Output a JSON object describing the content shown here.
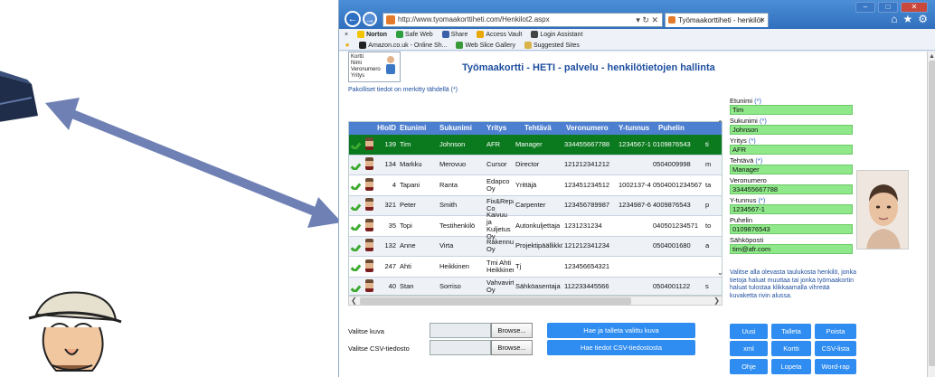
{
  "browser": {
    "url": "http://www.tyomaakorttiheti.com/Henkilot2.aspx",
    "tab_title": "Työmaakorttiheti - henkilöt",
    "toolbar_row1": [
      "Norton",
      "Safe Web",
      "Share",
      "Access Vault",
      "Login Assistant"
    ],
    "toolbar_row2": [
      "Amazon.co.uk - Online Sh...",
      "Web Slice Gallery",
      "Suggested Sites"
    ]
  },
  "logo": {
    "lines": [
      "Kortti",
      "Nimi",
      "Veronumero",
      "Yritys"
    ]
  },
  "page": {
    "title": "Työmaakortti - HETI - palvelu - henkilötietojen hallinta",
    "required_note": "Pakolliset tiedot on merkitty tähdellä (*)"
  },
  "table": {
    "headers": [
      "HloID",
      "Etunimi",
      "Sukunimi",
      "Yritys",
      "Tehtävä",
      "Veronumero",
      "Y-tunnus",
      "Puhelin"
    ],
    "rows": [
      [
        "139",
        "Tim",
        "Johnson",
        "AFR",
        "Manager",
        "334455667788",
        "1234567-1",
        "0109876543",
        "ti"
      ],
      [
        "134",
        "Markku",
        "Merovuo",
        "Cursor",
        "Director",
        "121212341212",
        "",
        "0504009998",
        "m"
      ],
      [
        "4",
        "Tapani",
        "Ranta",
        "Edapco Oy",
        "Yrittäjä",
        "123451234512",
        "1002137-4",
        "0504001234567",
        "ta"
      ],
      [
        "321",
        "Peter",
        "Smith",
        "Fix&Repair Co",
        "Carpenter",
        "123456789987",
        "1234987-6",
        "4009876543",
        "p"
      ],
      [
        "35",
        "Topi",
        "Testihenkilö",
        "Kaivuu ja Kuljetus Oy",
        "Autonkuljettaja",
        "1231231234",
        "",
        "040501234571",
        "to"
      ],
      [
        "132",
        "Anne",
        "Virta",
        "Rakennus Oy",
        "Projektipäällikkö",
        "121212341234",
        "",
        "0504001680",
        "a"
      ],
      [
        "247",
        "Ahti",
        "Heikkinen",
        "Tmi Ahti Heikkinen",
        "Tj",
        "123456654321",
        "",
        "",
        ""
      ],
      [
        "40",
        "Stan",
        "Sorriso",
        "Vahvavirta Oy",
        "Sähköasentaja",
        "112233445566",
        "",
        "0504001122",
        "s"
      ]
    ],
    "selected_row": 0
  },
  "bottom": {
    "valitse_kuva_label": "Valitse kuva",
    "valitse_csv_label": "Valitse CSV-tiedosto",
    "browse1": "Browse...",
    "browse2": "Browse...",
    "save_image_btn": "Hae ja talleta valittu kuva",
    "fetch_csv_btn": "Hae tiedot CSV-tiedostosta"
  },
  "form": {
    "etunimi_label": "Etunimi",
    "etunimi": "Tim",
    "sukunimi_label": "Sukunimi",
    "sukunimi": "Johnson",
    "yritys_label": "Yritys",
    "yritys": "AFR",
    "tehtava_label": "Tehtävä",
    "tehtava": "Manager",
    "veronumero_label": "Veronumero",
    "veronumero": "334455667788",
    "ytunnus_label": "Y-tunnus",
    "ytunnus": "1234567-1",
    "puhelin_label": "Puhelin",
    "puhelin": "0109876543",
    "sahkoposti_label": "Sähköposti",
    "sahkoposti": "tim@afr.com",
    "req_mark": "(*)"
  },
  "info_text": "Valitse alla olevasta taulukosta henkilö, jonka tietoja haluat muuttaa tai jonka työmaakortin haluat tulostaa klikkaamalla vihreää kuvaketta rivin alussa.",
  "actions": {
    "uusi": "Uusi",
    "talleta": "Talleta",
    "poista": "Poista",
    "xml": "xml",
    "kortti": "Kortti",
    "csv": "CSV-lista",
    "ohje": "Ohje",
    "lopeta": "Lopeta",
    "wordrap": "Word-rap"
  },
  "colors": {
    "accent": "#2f8cf0",
    "selected_row": "#0b7a1e",
    "field_green": "#8fe88a",
    "header_blue": "#4d7fd0"
  }
}
